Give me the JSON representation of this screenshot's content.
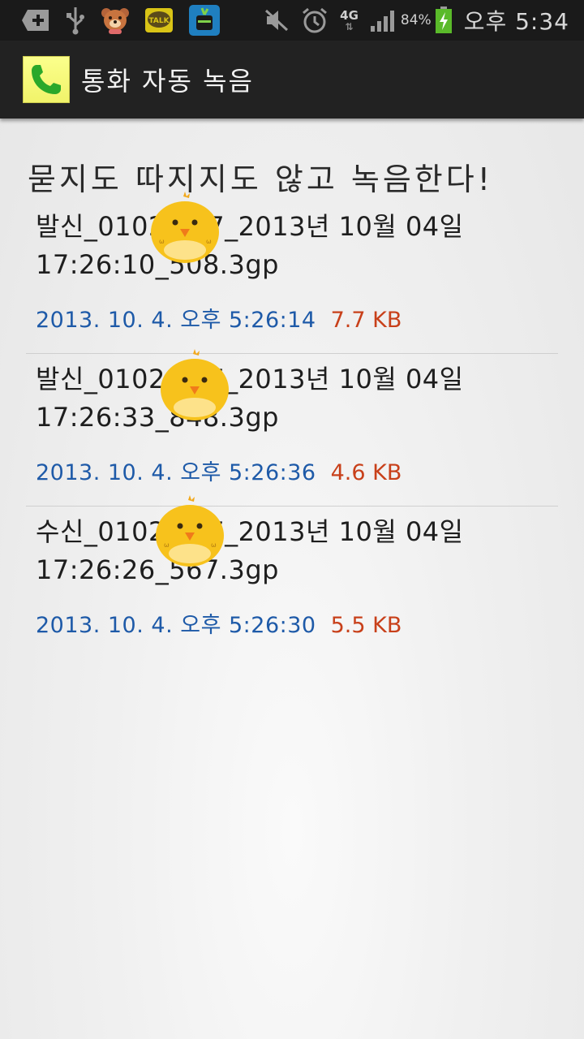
{
  "status_bar": {
    "icons_left": [
      "plus-icon",
      "usb-icon",
      "teddy-bear-icon",
      "kakaotalk-icon",
      "drink-app-icon"
    ],
    "kakao_label": "TALK",
    "network": "4G",
    "battery_percent": "84%",
    "clock": "오후 5:34"
  },
  "action_bar": {
    "title": "통화 자동 녹음",
    "icon": "phone-icon"
  },
  "main": {
    "headline": "묻지도 따지지도 않고 녹음한다!",
    "recordings": [
      {
        "name": "발신_0102   257_2013년 10월 04일\n17:26:10_508.3gp",
        "date": "2013. 10. 4. 오후 5:26:14",
        "size": "7.7 KB"
      },
      {
        "name": "발신_0102   257_2013년 10월 04일\n17:26:33_848.3gp",
        "date": "2013. 10. 4. 오후 5:26:36",
        "size": "4.6 KB"
      },
      {
        "name": "수신_0102   257_2013년 10월 04일\n17:26:26_567.3gp",
        "date": "2013. 10. 4. 오후 5:26:30",
        "size": "5.5 KB"
      }
    ]
  },
  "colors": {
    "date_text": "#1e5aa8",
    "size_text": "#c8401a",
    "app_icon_bg": "#f1f36a",
    "action_bar_bg": "#222222"
  }
}
